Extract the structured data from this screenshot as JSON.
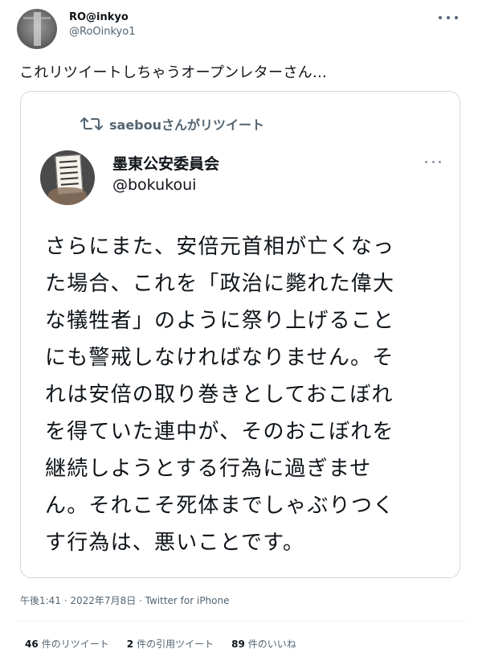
{
  "author": {
    "display_name": "RO@inkyo",
    "handle": "@RoOinkyo1"
  },
  "tweet_text": "これリツイートしちゃうオープンレターさん…",
  "quoted": {
    "retweet_label": "saebouさんがリツイート",
    "display_name": "墨東公安委員会",
    "handle": "@bokukoui",
    "lines": [
      "さらにまた、安倍元首相が亡くなっ",
      "た場合、これを「政治に斃れた偉大",
      "な犠牲者」のように祭り上げること",
      "にも警戒しなければなりません。そ",
      "れは安倍の取り巻きとしておこぼれ",
      "を得ていた連中が、そのおこぼれを",
      "継続しようとする行為に過ぎませ",
      "ん。それこそ死体までしゃぶりつく",
      "す行為は、悪いことです。"
    ]
  },
  "meta": "午後1:41 · 2022年7月8日 · Twitter for iPhone",
  "stats": {
    "retweets_count": "46",
    "retweets_label": "件のリツイート",
    "quotes_count": "2",
    "quotes_label": "件の引用ツイート",
    "likes_count": "89",
    "likes_label": "件のいいね"
  },
  "icons": {
    "avatar": "profile-photo",
    "more": "more-dots-icon",
    "retweet": "retweet-icon"
  },
  "colors": {
    "text": "#0f1419",
    "secondary": "#536471",
    "border": "#cfd9de"
  }
}
